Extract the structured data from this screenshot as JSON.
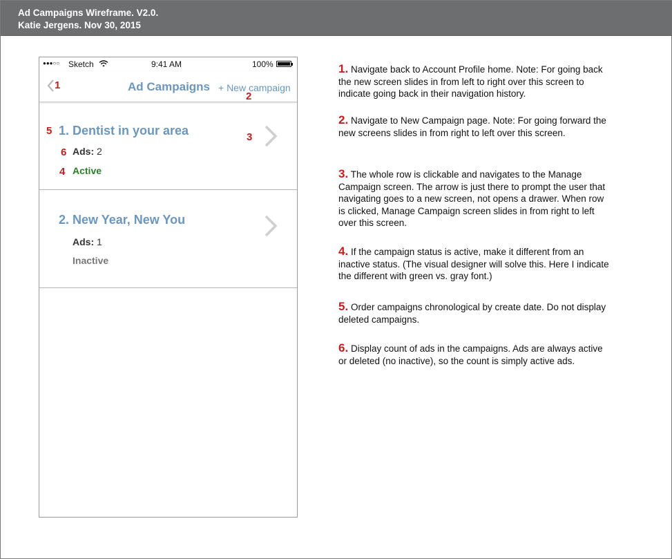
{
  "header": {
    "line1": "Ad Campaigns Wireframe. V2.0.",
    "line2": "Katie Jergens. Nov 30, 2015"
  },
  "statusbar": {
    "signal": "●●●○○",
    "carrier": "Sketch",
    "time": "9:41 AM",
    "battery": "100%"
  },
  "navbar": {
    "title": "Ad Campaigns",
    "action": "+ New campaign"
  },
  "campaigns": [
    {
      "title": "1. Dentist in your area",
      "ads_label": "Ads:",
      "ads_count": "2",
      "status": "Active",
      "status_color": "#2e7d2a"
    },
    {
      "title": "2. New Year, New You",
      "ads_label": "Ads:",
      "ads_count": "1",
      "status": "Inactive",
      "status_color": "#777777"
    }
  ],
  "markers": {
    "m1": "1",
    "m2": "2",
    "m3": "3",
    "m4": "4",
    "m5": "5",
    "m6": "6"
  },
  "notes": [
    {
      "num": "1.",
      "text": "Navigate back to Account Profile home. Note: For going back the new screen slides in from left to right over this screen to indicate going back in their navigation history."
    },
    {
      "num": "2.",
      "text": "Navigate to New Campaign page. Note: For going forward the new screens slides in from right to left over this screen."
    },
    {
      "num": "3.",
      "text": "The whole row is clickable and navigates to the Manage Campaign screen. The arrow is just there to prompt the user that navigating goes to a new screen, not opens a drawer. When row is clicked, Manage Campaign screen slides in from right to left over this screen."
    },
    {
      "num": "4.",
      "text": "If the campaign status is active, make it different from an inactive status. (The visual designer will solve this. Here I indicate the different with green vs. gray font.)"
    },
    {
      "num": "5.",
      "text": "Order campaigns chronological by create date. Do not display deleted campaigns."
    },
    {
      "num": "6.",
      "text": "Display count of ads in the campaigns. Ads are always active or deleted (no inactive), so the count is simply active ads."
    }
  ],
  "colors": {
    "header_bg": "#6d6e70",
    "link_blue": "#6c96bc",
    "marker_red": "#c01f1f",
    "active_green": "#2e7d2a",
    "inactive_gray": "#777777"
  }
}
